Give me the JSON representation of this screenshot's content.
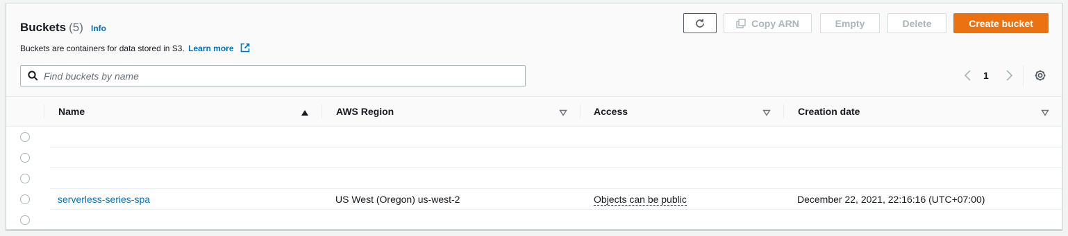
{
  "header": {
    "title": "Buckets",
    "count": "(5)",
    "info_label": "Info",
    "description": "Buckets are containers for data stored in S3.",
    "learn_more": "Learn more"
  },
  "actions": {
    "copy_arn": "Copy ARN",
    "empty": "Empty",
    "delete": "Delete",
    "create_bucket": "Create bucket"
  },
  "search": {
    "placeholder": "Find buckets by name",
    "value": ""
  },
  "pagination": {
    "current_page": "1"
  },
  "table": {
    "columns": [
      {
        "label": "Name",
        "sort": "ascending"
      },
      {
        "label": "AWS Region",
        "sort": "none"
      },
      {
        "label": "Access",
        "sort": "none"
      },
      {
        "label": "Creation date",
        "sort": "none"
      }
    ],
    "rows": [
      {
        "name": "",
        "region": "",
        "access": "",
        "created": ""
      },
      {
        "name": "",
        "region": "",
        "access": "",
        "created": ""
      },
      {
        "name": "",
        "region": "",
        "access": "",
        "created": ""
      },
      {
        "name": "serverless-series-spa",
        "region": "US West (Oregon) us-west-2",
        "access": "Objects can be public",
        "created": "December 22, 2021, 22:16:16 (UTC+07:00)"
      },
      {
        "name": "",
        "region": "",
        "access": "",
        "created": ""
      }
    ]
  },
  "colors": {
    "primary": "#ec7211",
    "link": "#0073bb",
    "border": "#d5dbdb"
  }
}
